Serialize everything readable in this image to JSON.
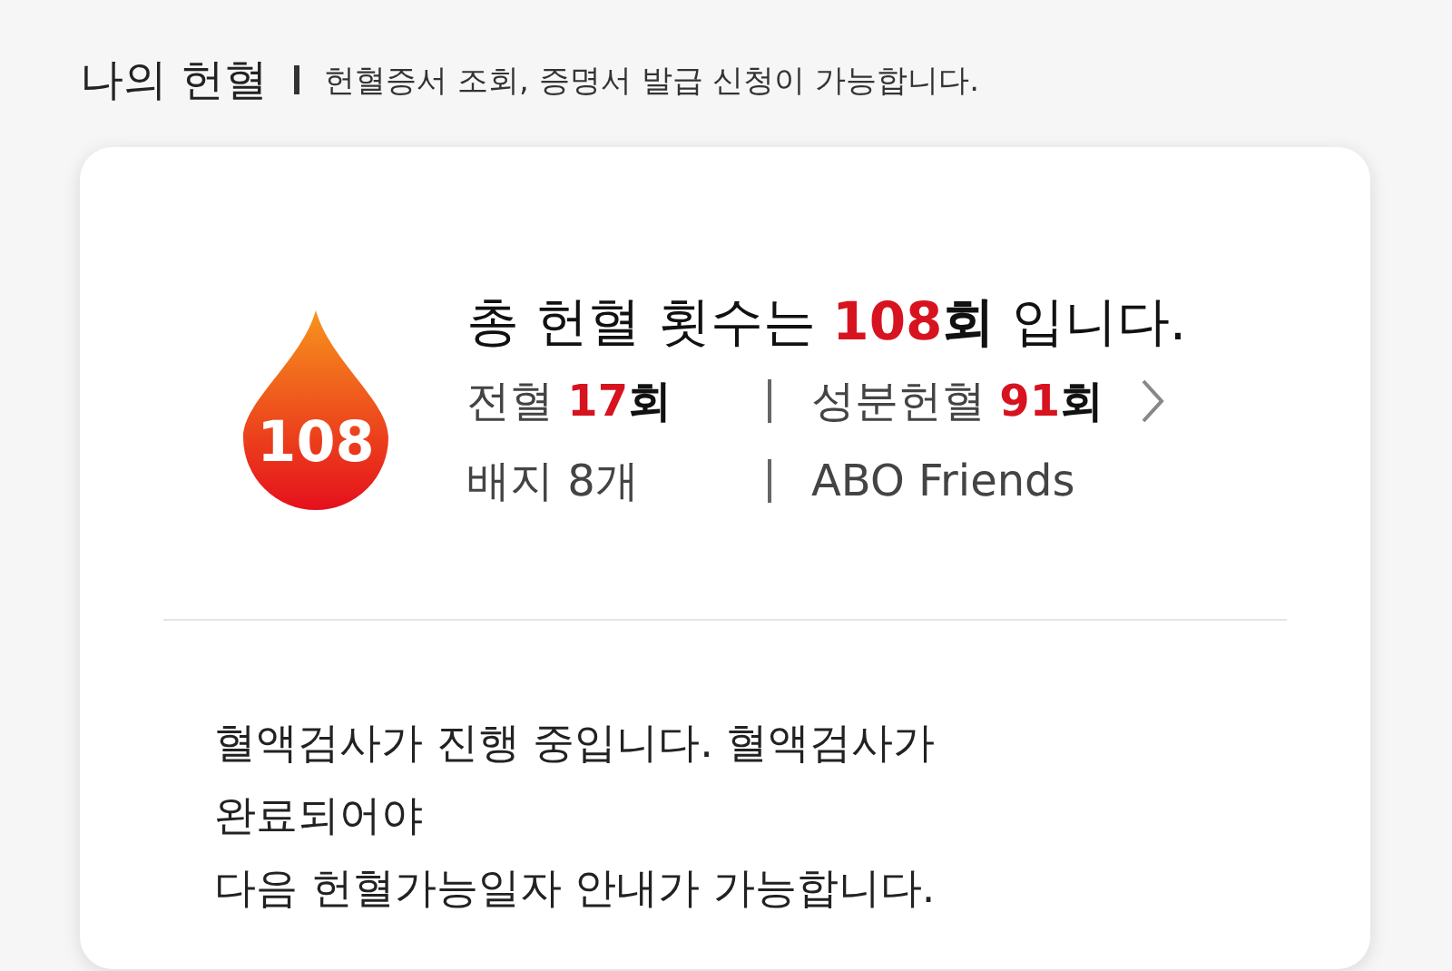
{
  "header": {
    "title": "나의 헌혈",
    "subtitle": "헌혈증서 조회, 증명서 발급 신청이 가능합니다."
  },
  "summary": {
    "badge": "108",
    "before": "총 헌혈 횟수는 ",
    "count": "108",
    "unit": "회",
    "after": " 입니다."
  },
  "stats": [
    [
      {
        "label": "전혈 ",
        "count": "17",
        "unit": "회",
        "link": false
      },
      {
        "label": "성분헌혈 ",
        "count": "91",
        "unit": "회",
        "link": true
      }
    ],
    [
      {
        "label": "배지 8개",
        "link": false
      },
      {
        "label": "ABO Friends",
        "link": false
      }
    ]
  ],
  "message": [
    "혈액검사가 진행 중입니다. 혈액검사가",
    "완료되어야",
    "다음 헌혈가능일자 안내가 가능합니다."
  ]
}
